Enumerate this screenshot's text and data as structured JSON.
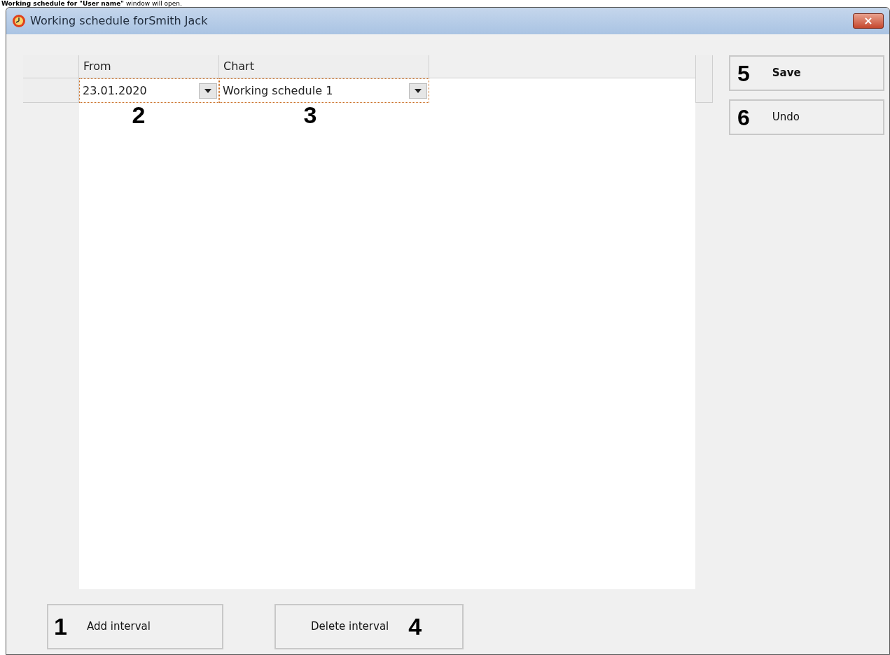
{
  "caption": "**Working schedule for \"User name\"** window will open.",
  "window": {
    "title": "Working schedule forSmith Jack",
    "close": "×"
  },
  "table": {
    "columns": [
      "From",
      "Chart"
    ],
    "rows": [
      {
        "cells": [
          {
            "value": "23.01.2020",
            "callout": "2"
          },
          {
            "value": "Working schedule 1",
            "callout": "3"
          }
        ],
        "selected": true
      }
    ]
  },
  "side_buttons": [
    {
      "label": "Save",
      "callout": "5",
      "bold": true
    },
    {
      "label": "Undo",
      "callout": "6",
      "bold": false
    }
  ],
  "bottom_buttons": [
    {
      "label": "Add interval",
      "callout": "1",
      "kind": "number-first"
    },
    {
      "label": "Delete interval",
      "callout": "4",
      "kind": "label-first"
    }
  ]
}
